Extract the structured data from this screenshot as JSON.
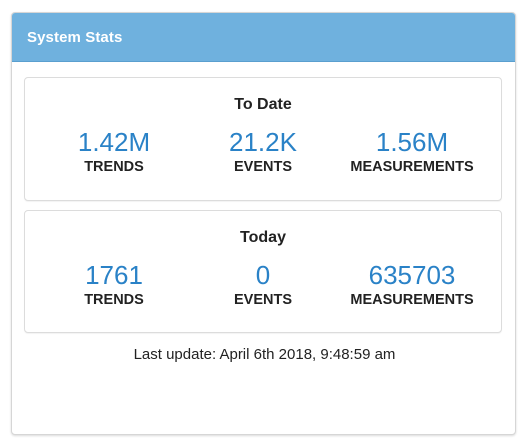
{
  "panel": {
    "title": "System Stats"
  },
  "to_date": {
    "title": "To Date",
    "stats": [
      {
        "value": "1.42M",
        "label": "TRENDS"
      },
      {
        "value": "21.2K",
        "label": "EVENTS"
      },
      {
        "value": "1.56M",
        "label": "MEASUREMENTS"
      }
    ]
  },
  "today": {
    "title": "Today",
    "stats": [
      {
        "value": "1761",
        "label": "TRENDS"
      },
      {
        "value": "0",
        "label": "EVENTS"
      },
      {
        "value": "635703",
        "label": "MEASUREMENTS"
      }
    ]
  },
  "last_update": "Last update: April 6th 2018, 9:48:59 am",
  "colors": {
    "header_bg": "#6fb1de",
    "value_text": "#2a82c7"
  }
}
